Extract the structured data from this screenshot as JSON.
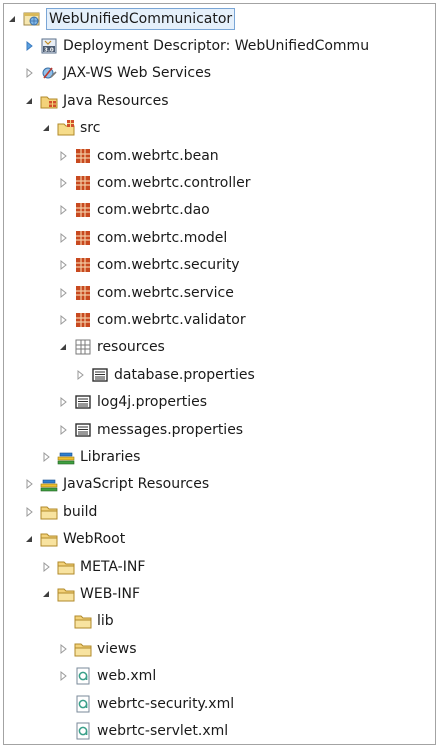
{
  "tree": [
    {
      "label": "WebUnifiedCommunicator",
      "depth": 0,
      "twisty": "expanded",
      "icon": "web-project-icon",
      "selected": true
    },
    {
      "label": "Deployment Descriptor: WebUnifiedCommu",
      "depth": 1,
      "twisty": "collapsed-blue",
      "icon": "deployment-descriptor-icon"
    },
    {
      "label": "JAX-WS Web Services",
      "depth": 1,
      "twisty": "collapsed",
      "icon": "web-services-icon"
    },
    {
      "label": "Java Resources",
      "depth": 1,
      "twisty": "expanded",
      "icon": "java-resources-icon"
    },
    {
      "label": "src",
      "depth": 2,
      "twisty": "expanded",
      "icon": "source-folder-icon"
    },
    {
      "label": "com.webrtc.bean",
      "depth": 3,
      "twisty": "collapsed",
      "icon": "package-icon"
    },
    {
      "label": "com.webrtc.controller",
      "depth": 3,
      "twisty": "collapsed",
      "icon": "package-icon"
    },
    {
      "label": "com.webrtc.dao",
      "depth": 3,
      "twisty": "collapsed",
      "icon": "package-icon"
    },
    {
      "label": "com.webrtc.model",
      "depth": 3,
      "twisty": "collapsed",
      "icon": "package-icon"
    },
    {
      "label": "com.webrtc.security",
      "depth": 3,
      "twisty": "collapsed",
      "icon": "package-icon"
    },
    {
      "label": "com.webrtc.service",
      "depth": 3,
      "twisty": "collapsed",
      "icon": "package-icon"
    },
    {
      "label": "com.webrtc.validator",
      "depth": 3,
      "twisty": "collapsed",
      "icon": "package-icon"
    },
    {
      "label": "resources",
      "depth": 3,
      "twisty": "expanded",
      "icon": "empty-package-icon"
    },
    {
      "label": "database.properties",
      "depth": 4,
      "twisty": "collapsed",
      "icon": "properties-file-icon"
    },
    {
      "label": "log4j.properties",
      "depth": 3,
      "twisty": "collapsed",
      "icon": "properties-file-icon"
    },
    {
      "label": "messages.properties",
      "depth": 3,
      "twisty": "collapsed",
      "icon": "properties-file-icon"
    },
    {
      "label": "Libraries",
      "depth": 2,
      "twisty": "collapsed",
      "icon": "libraries-icon"
    },
    {
      "label": "JavaScript Resources",
      "depth": 1,
      "twisty": "collapsed",
      "icon": "libraries-icon"
    },
    {
      "label": "build",
      "depth": 1,
      "twisty": "collapsed",
      "icon": "folder-icon"
    },
    {
      "label": "WebRoot",
      "depth": 1,
      "twisty": "expanded",
      "icon": "folder-icon"
    },
    {
      "label": "META-INF",
      "depth": 2,
      "twisty": "collapsed",
      "icon": "folder-icon"
    },
    {
      "label": "WEB-INF",
      "depth": 2,
      "twisty": "expanded",
      "icon": "folder-icon"
    },
    {
      "label": "lib",
      "depth": 3,
      "twisty": "none",
      "icon": "folder-icon"
    },
    {
      "label": "views",
      "depth": 3,
      "twisty": "collapsed",
      "icon": "folder-icon"
    },
    {
      "label": "web.xml",
      "depth": 3,
      "twisty": "collapsed",
      "icon": "xml-file-icon"
    },
    {
      "label": "webrtc-security.xml",
      "depth": 3,
      "twisty": "none",
      "icon": "xml-file-icon"
    },
    {
      "label": "webrtc-servlet.xml",
      "depth": 3,
      "twisty": "none",
      "icon": "xml-file-icon"
    }
  ]
}
